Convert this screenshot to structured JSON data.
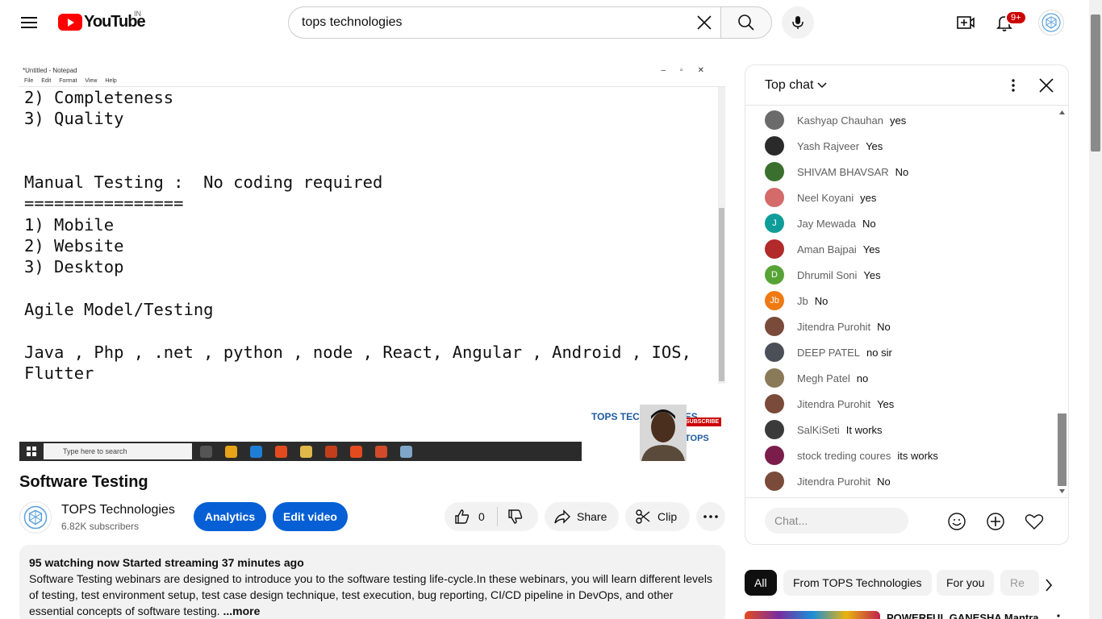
{
  "header": {
    "logo_text": "YouTube",
    "country_code": "IN",
    "search_value": "tops technologies",
    "notification_count": "9+"
  },
  "video": {
    "notepad_title": "*Untitled - Notepad",
    "notepad_menu": [
      "File",
      "Edit",
      "Format",
      "View",
      "Help"
    ],
    "notepad_text": "2) Completeness\n3) Quality\n\n\nManual Testing :  No coding required\n================\n1) Mobile\n2) Website\n3) Desktop\n\nAgile Model/Testing\n\nJava , Php , .net , python , node , React, Angular , Android , IOS,\nFlutter",
    "taskbar_search": "Type here to search",
    "overlay_logo": "TOPS TECHNOLOGIES",
    "overlay_subscribe": "SUBSCRIBE",
    "overlay_tops": "TOPS"
  },
  "info": {
    "title": "Software Testing",
    "channel_name": "TOPS Technologies",
    "subscribers": "6.82K subscribers",
    "analytics": "Analytics",
    "edit_video": "Edit video",
    "likes": "0",
    "share": "Share",
    "clip": "Clip"
  },
  "description": {
    "meta": "95 watching now  Started streaming 37 minutes ago",
    "text": "Software Testing webinars are designed to introduce you to the software testing life-cycle.In these webinars, you will learn different levels of testing, test environment setup, test case design technique, test execution, bug reporting, CI/CD pipeline in DevOps, and other essential concepts of software testing.",
    "more": "...more"
  },
  "chat": {
    "header": "Top chat",
    "placeholder": "Chat...",
    "messages": [
      {
        "author": "Kashyap Chauhan",
        "text": "yes",
        "color": "#6b6b6b",
        "initial": ""
      },
      {
        "author": "Yash Rajveer",
        "text": "Yes",
        "color": "#2a2a2a",
        "initial": ""
      },
      {
        "author": "SHIVAM BHAVSAR",
        "text": "No",
        "color": "#3b6f2d",
        "initial": ""
      },
      {
        "author": "Neel Koyani",
        "text": "yes",
        "color": "#d46a6a",
        "initial": ""
      },
      {
        "author": "Jay Mewada",
        "text": "No",
        "color": "#0f9d9a",
        "initial": "J"
      },
      {
        "author": "Aman Bajpai",
        "text": "Yes",
        "color": "#b22a2a",
        "initial": ""
      },
      {
        "author": "Dhrumil Soni",
        "text": "Yes",
        "color": "#58a336",
        "initial": "D"
      },
      {
        "author": "Jb",
        "text": "No",
        "color": "#ef7a13",
        "initial": "Jb"
      },
      {
        "author": "Jitendra Purohit",
        "text": "No",
        "color": "#7a4a3a",
        "initial": ""
      },
      {
        "author": "DEEP PATEL",
        "text": "no sir",
        "color": "#4a4f58",
        "initial": ""
      },
      {
        "author": "Megh Patel",
        "text": "no",
        "color": "#8a7a5a",
        "initial": ""
      },
      {
        "author": "Jitendra Purohit",
        "text": "Yes",
        "color": "#7a4a3a",
        "initial": ""
      },
      {
        "author": "SalKiSeti",
        "text": "It works",
        "color": "#3a3a3a",
        "initial": ""
      },
      {
        "author": "stock treding coures",
        "text": "its works",
        "color": "#7a1d4a",
        "initial": ""
      },
      {
        "author": "Jitendra Purohit",
        "text": "No",
        "color": "#7a4a3a",
        "initial": ""
      }
    ]
  },
  "chips": [
    "All",
    "From TOPS Technologies",
    "For you",
    "Re"
  ],
  "recommended": {
    "title": "POWERFUL GANESHA Mantra"
  }
}
